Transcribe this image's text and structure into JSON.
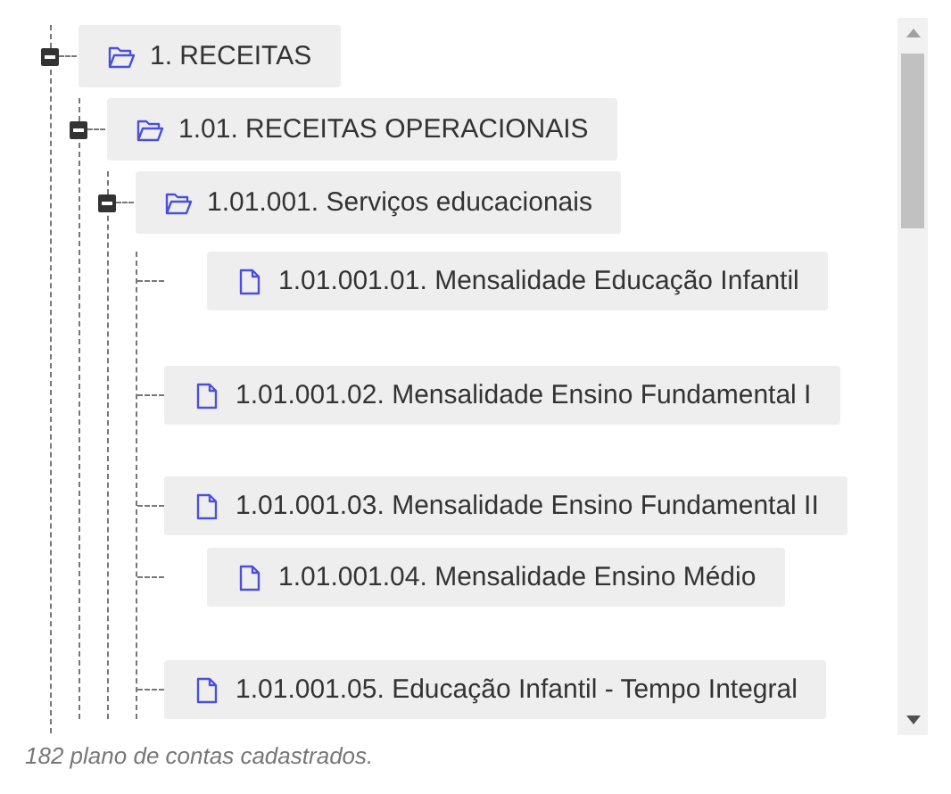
{
  "tree": [
    {
      "label": "1. RECEITAS",
      "kind": "folder",
      "expanded": true,
      "children": [
        {
          "label": "1.01. RECEITAS OPERACIONAIS",
          "kind": "folder",
          "expanded": true,
          "children": [
            {
              "label": "1.01.001. Serviços educacionais",
              "kind": "folder",
              "expanded": true,
              "children": [
                {
                  "label": "1.01.001.01. Mensalidade Educação Infantil",
                  "kind": "file"
                },
                {
                  "label": "1.01.001.02. Mensalidade Ensino Fundamental I",
                  "kind": "file"
                },
                {
                  "label": "1.01.001.03. Mensalidade Ensino Fundamental II",
                  "kind": "file"
                },
                {
                  "label": "1.01.001.04. Mensalidade Ensino Médio",
                  "kind": "file"
                },
                {
                  "label": "1.01.001.05. Educação Infantil - Tempo Integral",
                  "kind": "file"
                }
              ]
            }
          ]
        }
      ]
    }
  ],
  "status": "182 plano de contas cadastrados."
}
